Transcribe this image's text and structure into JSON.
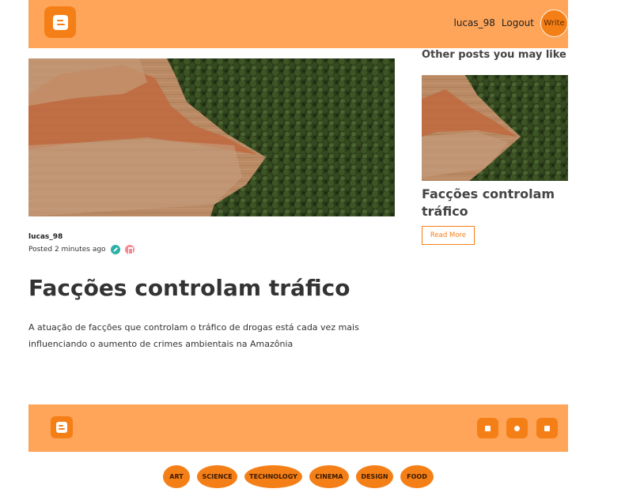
{
  "nav": {
    "username": "lucas_98",
    "logout_label": "Logout",
    "write_label": "Write"
  },
  "post": {
    "author": "lucas_98",
    "posted": "Posted 2 minutes ago",
    "title": "Facções controlam tráfico",
    "description": "A atuação de facções que controlam o tráfico de drogas está cada vez mais influenciando o aumento de crimes ambientais na Amazônia"
  },
  "sidebar": {
    "heading": "Other posts you may like",
    "card_title": "Facções controlam tráfico",
    "read_more_label": "Read More"
  },
  "footer": {
    "social_icons": [
      "linkedin-icon",
      "github-icon",
      "instagram-icon"
    ]
  },
  "categories": [
    "ART",
    "SCIENCE",
    "TECHNOLOGY",
    "CINEMA",
    "DESIGN",
    "FOOD"
  ],
  "colors": {
    "header_bg": "#ffa559",
    "accent": "#f57f17",
    "text": "#333333"
  }
}
